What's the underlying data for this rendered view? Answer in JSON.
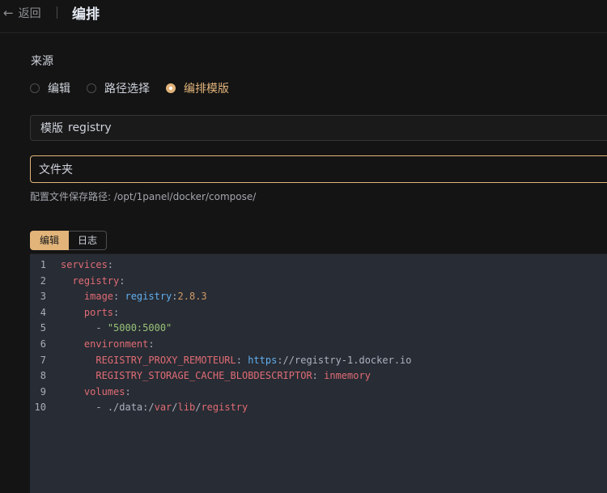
{
  "header": {
    "back_label": "返回",
    "title": "编排"
  },
  "form": {
    "source_label": "来源",
    "radios": [
      {
        "label": "编辑",
        "checked": false
      },
      {
        "label": "路径选择",
        "checked": false
      },
      {
        "label": "编排模版",
        "checked": true
      }
    ],
    "template_prefix": "模版",
    "template_value": "registry",
    "folder_placeholder": "文件夹",
    "path_hint": "配置文件保存路径: /opt/1panel/docker/compose/"
  },
  "tabs": [
    {
      "label": "编辑",
      "active": true
    },
    {
      "label": "日志",
      "active": false
    }
  ],
  "editor": {
    "lines": [
      {
        "num": "1",
        "indent": "",
        "key": "services",
        "sep": ":",
        "value": ""
      },
      {
        "num": "2",
        "indent": "  ",
        "key": "registry",
        "sep": ":",
        "value": ""
      },
      {
        "num": "3",
        "indent": "    ",
        "key": "image",
        "sep": ": ",
        "value": "registry:2.8.3"
      },
      {
        "num": "4",
        "indent": "    ",
        "key": "ports",
        "sep": ":",
        "value": ""
      },
      {
        "num": "5",
        "indent": "      ",
        "key": "",
        "sep": "- ",
        "value": "\"5000:5000\""
      },
      {
        "num": "6",
        "indent": "    ",
        "key": "environment",
        "sep": ":",
        "value": ""
      },
      {
        "num": "7",
        "indent": "      ",
        "key": "REGISTRY_PROXY_REMOTEURL",
        "sep": ": ",
        "value": "https://registry-1.docker.io"
      },
      {
        "num": "8",
        "indent": "      ",
        "key": "REGISTRY_STORAGE_CACHE_BLOBDESCRIPTOR",
        "sep": ": ",
        "value": "inmemory"
      },
      {
        "num": "9",
        "indent": "    ",
        "key": "volumes",
        "sep": ":",
        "value": ""
      },
      {
        "num": "10",
        "indent": "      ",
        "key": "",
        "sep": "- ",
        "value": "./data:/var/lib/registry"
      }
    ]
  },
  "colors": {
    "accent": "#e2b47a",
    "background": "#141414",
    "editor_bg": "#282c34"
  },
  "icons": {
    "back": "arrow-left-icon"
  }
}
